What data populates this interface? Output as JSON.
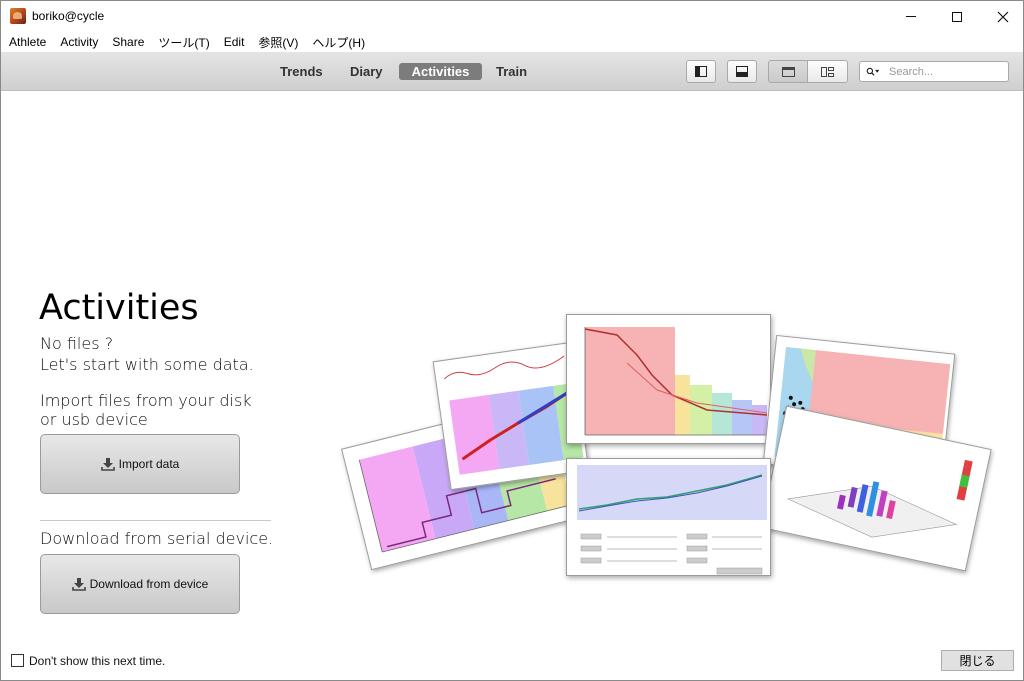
{
  "window": {
    "title": "boriko@cycle"
  },
  "menubar": {
    "items": [
      "Athlete",
      "Activity",
      "Share",
      "ツール(T)",
      "Edit",
      "参照(V)",
      "ヘルプ(H)"
    ]
  },
  "toolbar": {
    "tabs": [
      "Trends",
      "Diary",
      "Activities",
      "Train"
    ],
    "active_tab": "Activities",
    "search_placeholder": "Search..."
  },
  "main": {
    "heading": "Activities",
    "no_files_line1": "No files ?",
    "no_files_line2": "Let's start with some data.",
    "import_desc_line1": "Import files from your disk",
    "import_desc_line2": "or usb device",
    "import_button": "Import data",
    "download_desc": "Download from serial device.",
    "download_button": "Download from device"
  },
  "footer": {
    "dont_show_label": "Don't show this next time.",
    "close_button": "閉じる"
  },
  "colors": {
    "accent_tab": "#7c7c7c",
    "toolbar_top": "#e4e4e4",
    "toolbar_bottom": "#cfcfcf"
  }
}
